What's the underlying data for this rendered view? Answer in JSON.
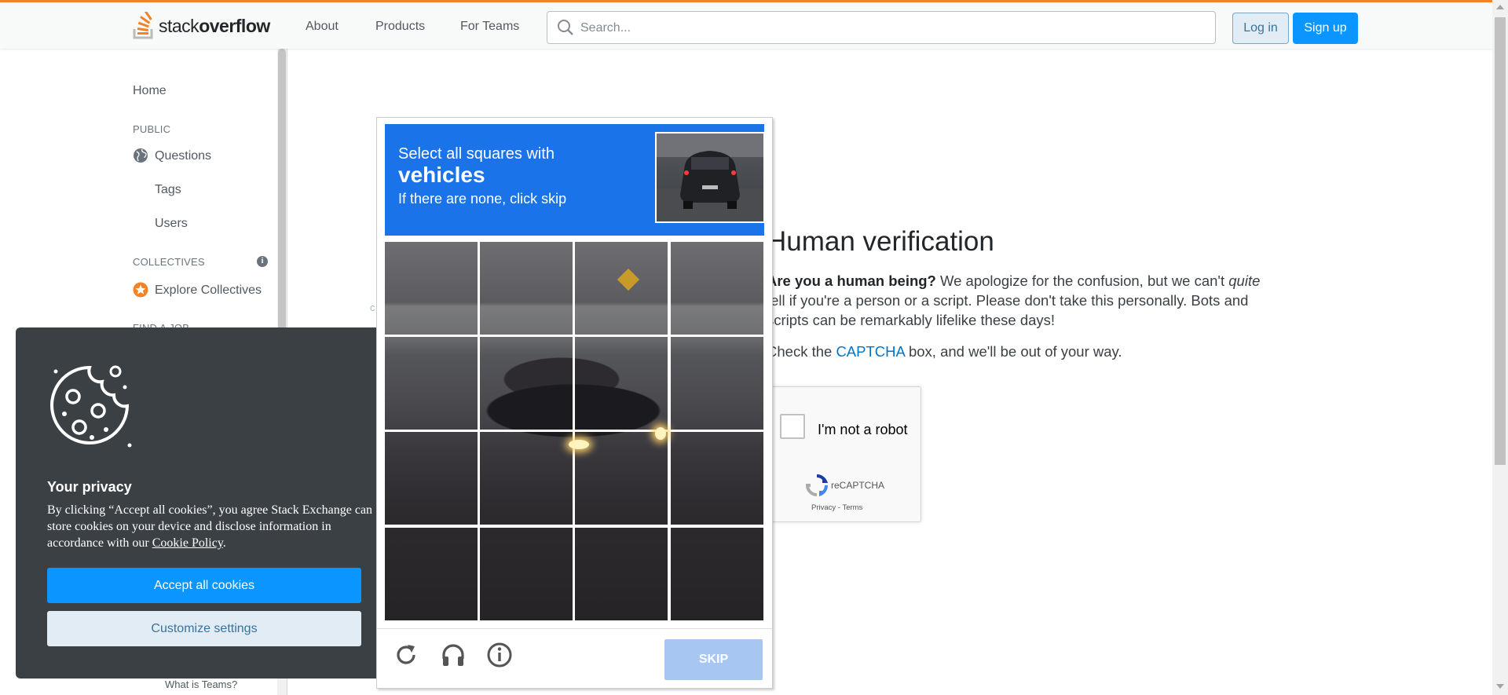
{
  "header": {
    "logo_prefix": "stack",
    "logo_bold": "overflow",
    "nav": [
      "About",
      "Products",
      "For Teams"
    ],
    "search_placeholder": "Search...",
    "login": "Log in",
    "signup": "Sign up",
    "accent_color": "#f48225"
  },
  "sidebar": {
    "home": "Home",
    "public_heading": "PUBLIC",
    "questions": "Questions",
    "tags": "Tags",
    "users": "Users",
    "collectives_heading": "COLLECTIVES",
    "explore_collectives": "Explore Collectives",
    "find_job_heading": "FIND A JOB",
    "teams_link": "What is Teams?"
  },
  "main": {
    "title": "Human verification",
    "p1_bold": "Are you a human being?",
    "p1_text_a": " We apologize for the confusion, but we can't ",
    "p1_italic": "quite",
    "p1_text_b": " tell if you're a person or a script. Please don't take this personally. Bots and scripts can be remarkably lifelike these days!",
    "p2_a": "Check the ",
    "p2_link": "CAPTCHA",
    "p2_b": " box, and we'll be out of your way.",
    "faint_char": "c"
  },
  "recaptcha": {
    "label": "I'm not a robot",
    "brand": "reCAPTCHA",
    "privacy": "Privacy",
    "separator": " - ",
    "terms": "Terms"
  },
  "challenge": {
    "line1": "Select all squares with",
    "target": "vehicles",
    "line3": "If there are none, click skip",
    "skip": "SKIP",
    "header_color": "#1a73e8",
    "icons": [
      "reload-icon",
      "audio-icon",
      "info-icon"
    ]
  },
  "cookie": {
    "title": "Your privacy",
    "text_a": "By clicking “Accept all cookies”, you agree Stack Exchange can store cookies on your device and disclose information in accordance with our ",
    "policy_link": "Cookie Policy",
    "text_b": ".",
    "accept": "Accept all cookies",
    "customize": "Customize settings"
  }
}
